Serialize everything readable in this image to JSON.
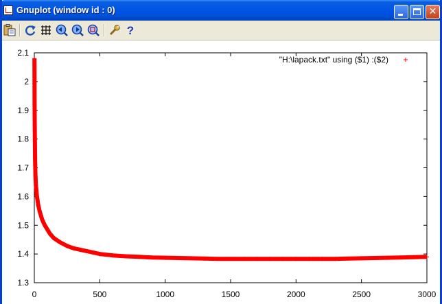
{
  "window": {
    "title": "Gnuplot (window id : 0)",
    "buttons": [
      "minimize",
      "maximize",
      "close"
    ]
  },
  "toolbar": {
    "icons": [
      "paste-icon",
      "replot-icon",
      "grid-icon",
      "zoom-back-icon",
      "zoom-forward-icon",
      "zoom-icon",
      "options-icon",
      "help-icon"
    ],
    "help_label": "?"
  },
  "colors": {
    "titlebar": "#0055e5",
    "series": "#ff0000",
    "toolbar_bg": "#ece9d8"
  },
  "chart_data": {
    "type": "scatter",
    "title": "",
    "xlabel": "",
    "ylabel": "",
    "xlim": [
      0,
      3000
    ],
    "ylim": [
      1.3,
      2.1
    ],
    "xticks": [
      "0",
      "500",
      "1000",
      "1500",
      "2000",
      "2500",
      "3000"
    ],
    "yticks": [
      "1.3",
      "1.4",
      "1.5",
      "1.6",
      "1.7",
      "1.8",
      "1.9",
      "2",
      "2.1"
    ],
    "legend": {
      "position": "top-right",
      "label": "\"H:\\lapack.txt\" using ($1) :($2)",
      "marker": "+"
    },
    "series": [
      {
        "name": "\"H:\\lapack.txt\" using ($1) :($2)",
        "marker": "+",
        "color": "#ff0000",
        "x": [
          1,
          2,
          3,
          4,
          5,
          6,
          7,
          8,
          9,
          10,
          12,
          14,
          16,
          18,
          20,
          25,
          30,
          35,
          40,
          50,
          60,
          70,
          80,
          100,
          120,
          150,
          200,
          250,
          300,
          400,
          500,
          600,
          700,
          800,
          900,
          1000,
          1100,
          1200,
          1300,
          1400,
          1500,
          1600,
          1700,
          1800,
          1900,
          2000,
          2100,
          2200,
          2300,
          2400,
          2500,
          2600,
          2700,
          2800,
          2900,
          3000
        ],
        "y": [
          2.08,
          1.92,
          1.85,
          1.8,
          1.76,
          1.73,
          1.71,
          1.69,
          1.67,
          1.66,
          1.64,
          1.63,
          1.62,
          1.61,
          1.6,
          1.585,
          1.57,
          1.56,
          1.55,
          1.535,
          1.52,
          1.51,
          1.5,
          1.485,
          1.47,
          1.455,
          1.44,
          1.428,
          1.42,
          1.41,
          1.4,
          1.395,
          1.392,
          1.39,
          1.388,
          1.387,
          1.386,
          1.385,
          1.384,
          1.383,
          1.383,
          1.383,
          1.383,
          1.383,
          1.383,
          1.383,
          1.383,
          1.383,
          1.383,
          1.384,
          1.385,
          1.386,
          1.387,
          1.388,
          1.389,
          1.39
        ]
      }
    ]
  }
}
